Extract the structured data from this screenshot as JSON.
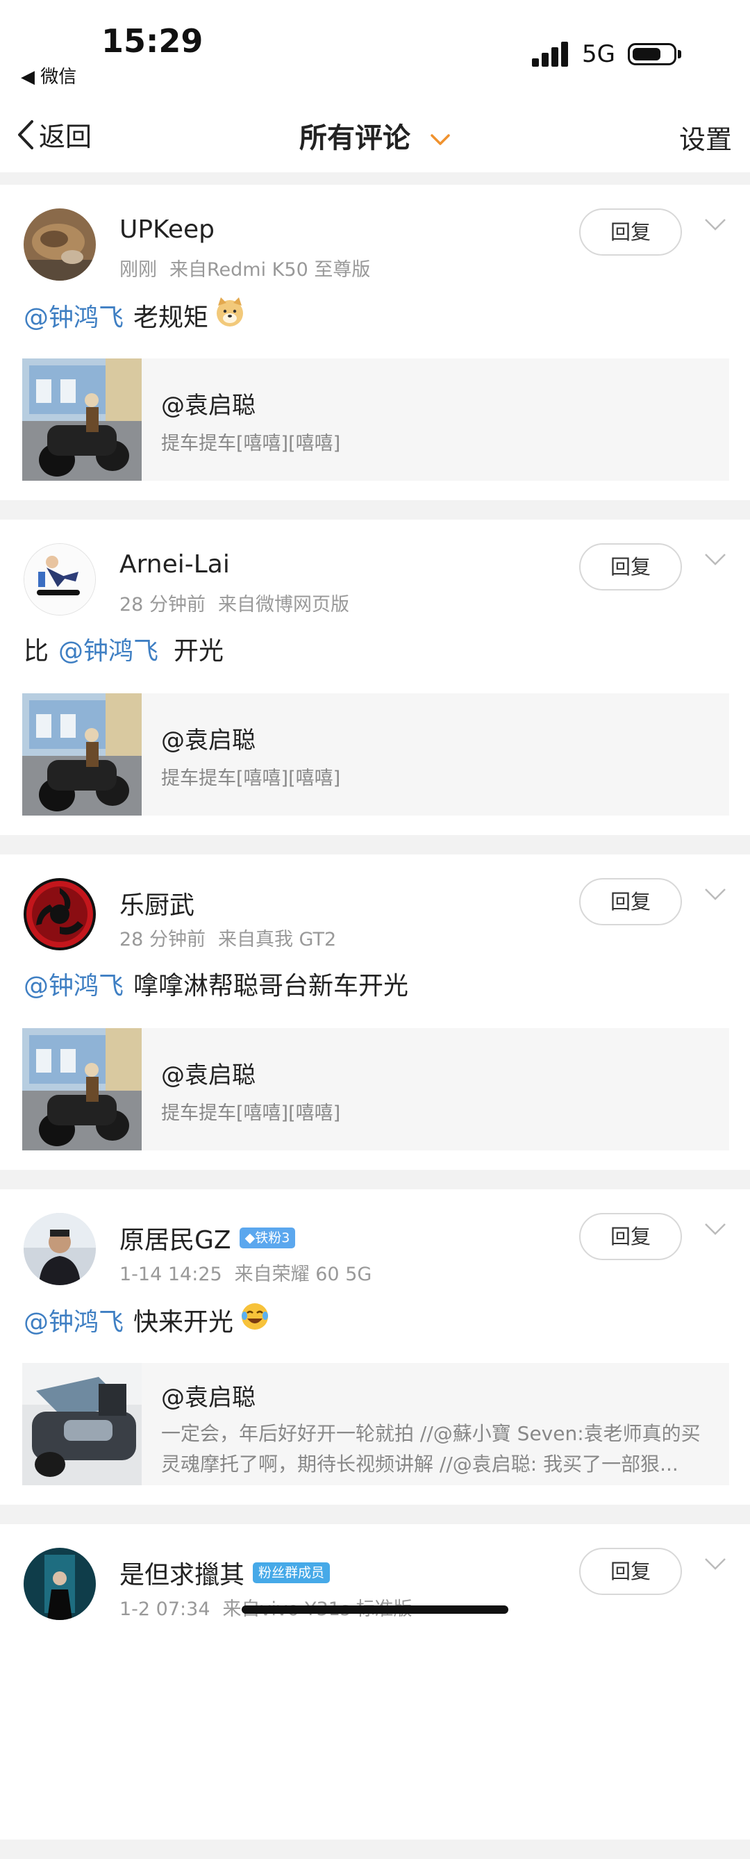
{
  "status_bar": {
    "time": "15:29",
    "back_app": "◀ 微信",
    "network": "5G"
  },
  "nav": {
    "back_label": "返回",
    "title": "所有评论",
    "settings_label": "设置"
  },
  "comments": [
    {
      "username": "UPKeep",
      "badge": "",
      "time": "刚刚",
      "source": "来自Redmi K50 至尊版",
      "reply_label": "回复",
      "mention": "@钟鸿飞",
      "prefix": "",
      "text": "老规矩",
      "emoji": "doge-emoji",
      "quote": {
        "author": "@袁启聪",
        "text": "提车提车[嘻嘻][嘻嘻]"
      }
    },
    {
      "username": "Arnei-Lai",
      "badge": "",
      "time": "28 分钟前",
      "source": "来自微博网页版",
      "reply_label": "回复",
      "mention": "@钟鸿飞",
      "prefix": "比",
      "text": "开光",
      "quote": {
        "author": "@袁启聪",
        "text": "提车提车[嘻嘻][嘻嘻]"
      }
    },
    {
      "username": "乐厨武",
      "badge": "",
      "time": "28 分钟前",
      "source": "来自真我 GT2",
      "reply_label": "回复",
      "mention": "@钟鸿飞",
      "prefix": "",
      "text": "嗱嗱淋帮聪哥台新车开光",
      "quote": {
        "author": "@袁启聪",
        "text": "提车提车[嘻嘻][嘻嘻]"
      }
    },
    {
      "username": "原居民GZ",
      "badge": "铁粉3",
      "time": "1-14 14:25",
      "source": "来自荣耀 60 5G",
      "reply_label": "回复",
      "mention": "@钟鸿飞",
      "prefix": "",
      "text": "快来开光",
      "emoji": "laugh-cry-emoji",
      "quote": {
        "author": "@袁启聪",
        "line1": "一定会，年后好好开一轮就拍 //@蘇小寶 Seven:袁老师真的买",
        "line2": "灵魂摩托了啊，期待长视频讲解 //@袁启聪: 我买了一部狠..."
      }
    },
    {
      "username": "是但求擸其",
      "badge": "粉丝群成员",
      "time": "1-2 07:34",
      "source": "来自vivo Y31s 标准版",
      "reply_label": "回复"
    }
  ],
  "colors": {
    "mention": "#3f7fc3",
    "meta": "#999999",
    "badge_blue": "#5ba7ee"
  }
}
